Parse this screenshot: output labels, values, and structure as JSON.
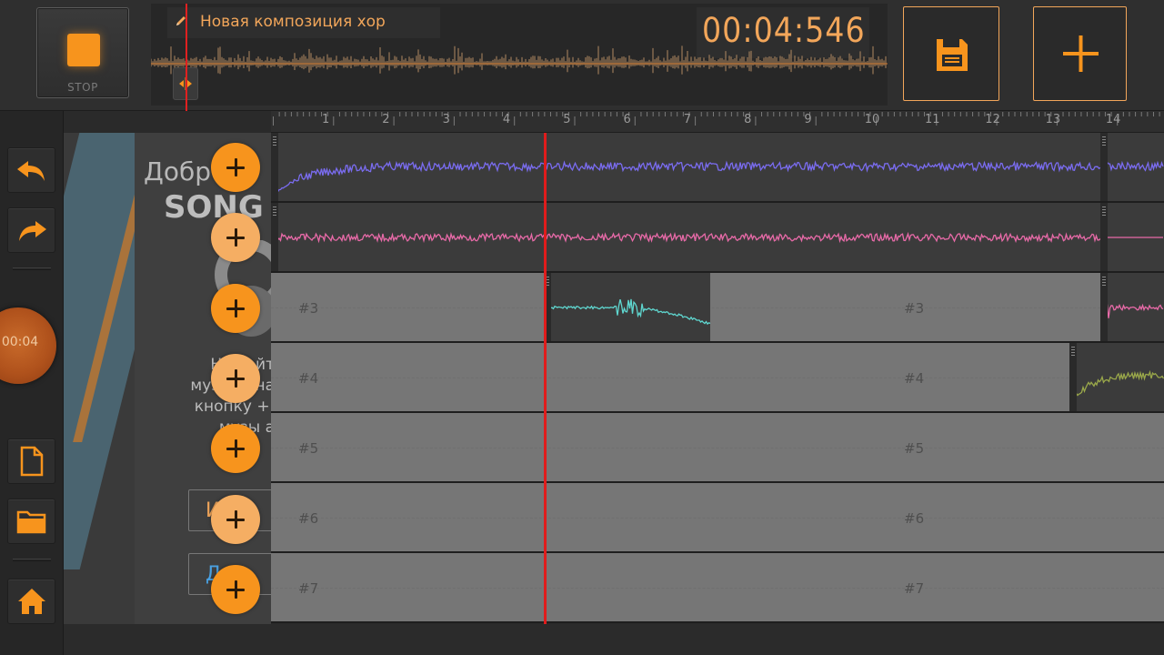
{
  "transport": {
    "stop_label": "STOP",
    "project_title": "Новая композиция хор",
    "time": "00:04:546"
  },
  "toolbar": {
    "undo": "undo-icon",
    "redo": "redo-icon",
    "new_file": "file-icon",
    "open_folder": "folder-icon",
    "home": "home-icon",
    "knob_time": "00:04"
  },
  "top_buttons": {
    "save": "save-icon",
    "add": "plus-icon"
  },
  "ruler": {
    "marks": [
      "1",
      "2",
      "3",
      "4",
      "5",
      "6",
      "7",
      "8",
      "9",
      "10",
      "11",
      "12",
      "13",
      "14"
    ]
  },
  "promo": {
    "greeting": "Добро п",
    "song": "SONG",
    "text_lines": [
      "Начи  йт",
      "музыку на",
      "кнопку +,",
      "музы   а"
    ],
    "button1": "И",
    "button2": "Д"
  },
  "tracks": [
    {
      "id": "track-1",
      "label": "",
      "color": "#7a6cf0"
    },
    {
      "id": "track-2",
      "label": "",
      "color": "#e86aa8"
    },
    {
      "id": "track-3",
      "label": "#3",
      "label2": "#3",
      "color": "#5fd7d0"
    },
    {
      "id": "track-4",
      "label": "#4",
      "label2": "#4",
      "color": "#9aa84a"
    },
    {
      "id": "track-5",
      "label": "#5",
      "label2": "#5"
    },
    {
      "id": "track-6",
      "label": "#6",
      "label2": "#6"
    },
    {
      "id": "track-7",
      "label": "#7",
      "label2": "#7"
    }
  ],
  "colors": {
    "accent": "#f7941d",
    "accent_text": "#f2a65a",
    "playhead": "#e01c1c"
  }
}
